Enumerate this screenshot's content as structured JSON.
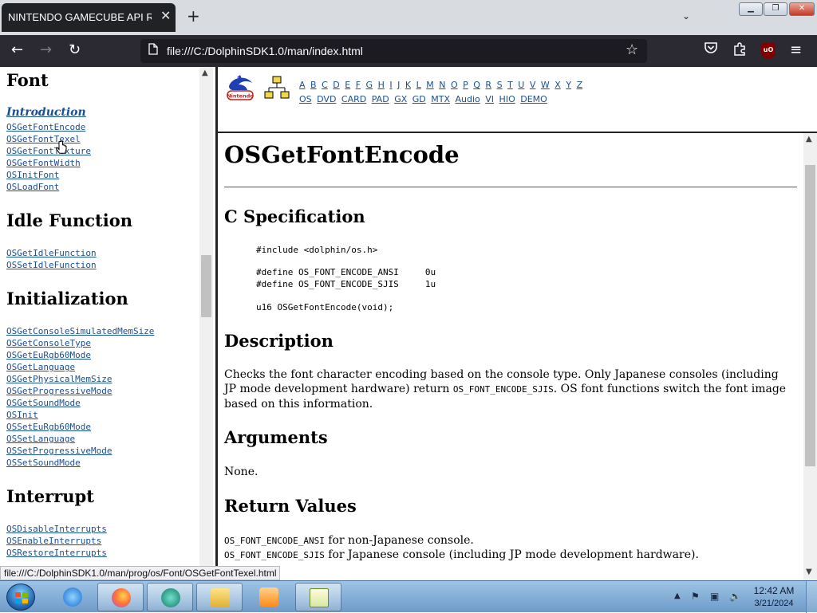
{
  "browser": {
    "tab_title": "NINTENDO GAMECUBE API Reference",
    "tab_close": "✕",
    "new_tab": "+",
    "list_tabs": "⌄",
    "url": "file:///C:/DolphinSDK1.0/man/index.html",
    "status_link": "file:///C:/DolphinSDK1.0/man/prog/os/Font/OSGetFontTexel.html"
  },
  "window_controls": {
    "minimize": "▁",
    "maximize": "❐",
    "close": "✕"
  },
  "nav_icons": {
    "back": "back-arrow-icon",
    "forward": "forward-arrow-icon",
    "reload": "reload-icon",
    "bookmark": "star-icon",
    "pocket": "pocket-icon",
    "extensions": "puzzle-icon",
    "ublock": "ublock-icon",
    "menu": "hamburger-icon"
  },
  "nav_glyphs": {
    "back": "←",
    "forward": "→",
    "reload": "↻",
    "page": "🗋",
    "star": "☆",
    "pocket": "♡",
    "extensions": "⧉",
    "ublock": "uO",
    "menu": "≡"
  },
  "sidebar": {
    "sections": [
      {
        "title": "Font",
        "links": [
          "Introduction",
          "OSGetFontEncode",
          "OSGetFontTexel",
          "OSGetFontTexture",
          "OSGetFontWidth",
          "OSInitFont",
          "OSLoadFont"
        ]
      },
      {
        "title": "Idle Function",
        "links": [
          "OSGetIdleFunction",
          "OSSetIdleFunction"
        ]
      },
      {
        "title": "Initialization",
        "links": [
          "OSGetConsoleSimulatedMemSize",
          "OSGetConsoleType",
          "OSGetEuRgb60Mode",
          "OSGetLanguage",
          "OSGetPhysicalMemSize",
          "OSGetProgressiveMode",
          "OSGetSoundMode",
          "OSInit",
          "OSSetEuRgb60Mode",
          "OSSetLanguage",
          "OSSetProgressiveMode",
          "OSSetSoundMode"
        ]
      },
      {
        "title": "Interrupt",
        "links": [
          "OSDisableInterrupts",
          "OSEnableInterrupts",
          "OSRestoreInterrupts"
        ]
      }
    ],
    "scroll_up": "▲"
  },
  "top_nav": {
    "letters": [
      "A",
      "B",
      "C",
      "D",
      "E",
      "F",
      "G",
      "H",
      "I",
      "J",
      "K",
      "L",
      "M",
      "N",
      "O",
      "P",
      "Q",
      "R",
      "S",
      "T",
      "U",
      "V",
      "W",
      "X",
      "Y",
      "Z"
    ],
    "modules": [
      "OS",
      "DVD",
      "CARD",
      "PAD",
      "GX",
      "GD",
      "MTX",
      "Audio",
      "VI",
      "HIO",
      "DEMO"
    ],
    "logo_text": "Nintendo"
  },
  "main": {
    "title": "OSGetFontEncode",
    "spec_heading": "C Specification",
    "code_include": "#include <dolphin/os.h>",
    "code_defines": "#define OS_FONT_ENCODE_ANSI     0u\n#define OS_FONT_ENCODE_SJIS     1u",
    "code_proto": "u16 OSGetFontEncode(void);",
    "desc_heading": "Description",
    "desc_part1": "Checks the font character encoding based on the console type. Only Japanese consoles (including JP mode development hardware) return ",
    "desc_code": "OS_FONT_ENCODE_SJIS",
    "desc_part2": ". OS font functions switch the font image based on this information.",
    "args_heading": "Arguments",
    "args_text": "None.",
    "ret_heading": "Return Values",
    "ret1_code": "OS_FONT_ENCODE_ANSI",
    "ret1_text": " for non-Japanese console.",
    "ret2_code": "OS_FONT_ENCODE_SJIS",
    "ret2_text": " for Japanese console (including JP mode development hardware).",
    "scroll_up": "▲",
    "scroll_down": "▼"
  },
  "taskbar": {
    "apps": [
      "ie-icon",
      "firefox-icon",
      "app-icon",
      "explorer-icon",
      "media-player-icon",
      "notepad-icon"
    ],
    "tray_arrow": "▲",
    "tray_icons": {
      "flag": "⚑",
      "network": "▣",
      "volume": "🔈"
    },
    "time": "12:42 AM",
    "date": "3/21/2024"
  },
  "colors": {
    "link": "#1a4f94",
    "tab_bg": "#202225",
    "toolbar_bg": "#2b2a33",
    "urlbar_bg": "#1c1b22"
  }
}
